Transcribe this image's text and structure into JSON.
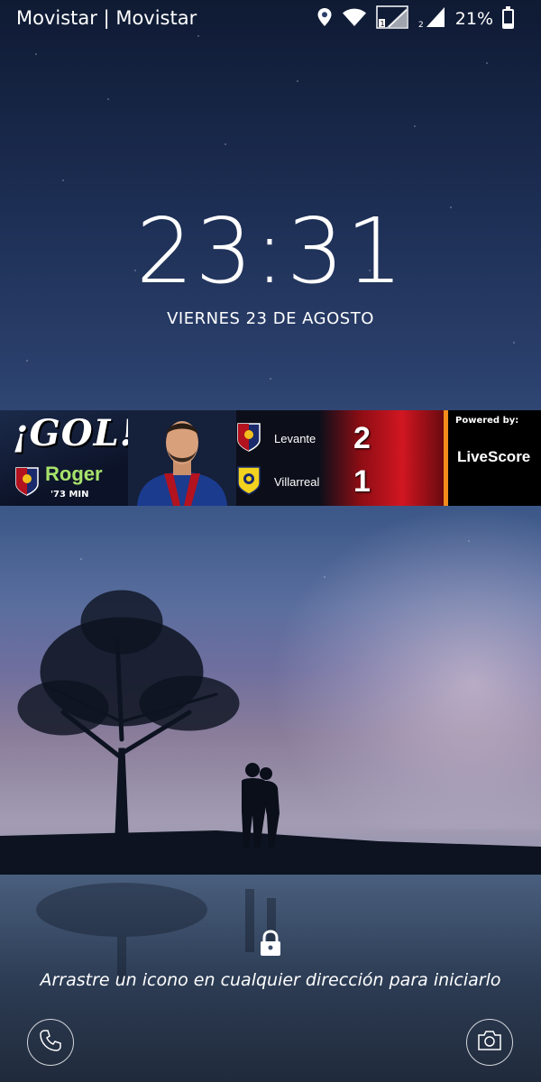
{
  "status_bar": {
    "carrier": "Movistar  |  Movistar",
    "battery_percent": "21%",
    "battery_level": 0.21,
    "icons": [
      "location-icon",
      "wifi-icon",
      "signal-sim1-icon",
      "signal-sim2-icon",
      "battery-icon"
    ]
  },
  "lockscreen": {
    "time": "23:31",
    "date": "VIERNES 23 DE AGOSTO",
    "unlock_hint": "Arrastre un icono en cualquier dirección para iniciarlo",
    "shortcuts": {
      "left": "phone-icon",
      "right": "camera-icon"
    }
  },
  "notification_banner": {
    "headline": "¡GOL!",
    "scorer": "Roger",
    "minute": "'73 MIN",
    "home_team": "Levante",
    "home_score": "2",
    "away_team": "Villarreal",
    "away_score": "1",
    "powered_by_label": "Powered by:",
    "provider": "LiveScore",
    "colors": {
      "accent": "#f28c1a",
      "heart": "#d11621",
      "scorer_green": "#a7e36b"
    }
  }
}
